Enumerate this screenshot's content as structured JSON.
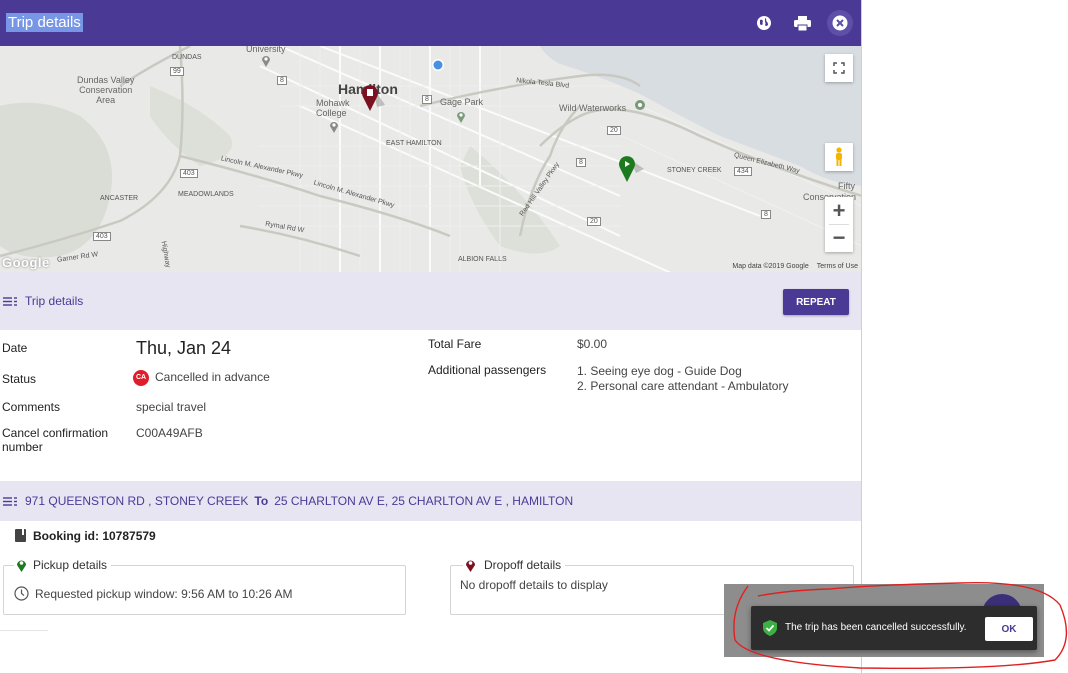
{
  "header": {
    "title": "Trip details",
    "icons": [
      "globe-icon",
      "print-icon",
      "close-icon"
    ]
  },
  "map": {
    "labels": {
      "hamilton": "Hamilton",
      "dundas_valley": "Dundas Valley\nConservation\nArea",
      "dundas": "DUNDAS",
      "university": "University",
      "mohawk": "Mohawk\nCollege",
      "gage_park": "Gage Park",
      "wild_waterworks": "Wild Waterworks",
      "nikola_tesla": "Nikola Tesla Blvd",
      "east_hamilton": "EAST HAMILTON",
      "stoney_creek": "STONEY CREEK",
      "queen_elizabeth": "Queen Elizabeth Way",
      "lincoln_alex": "Lincoln M. Alexander Pkwy",
      "lincoln_alex2": "Lincoln M. Alexander Pkwy",
      "meadowlands": "MEADOWLANDS",
      "ancaster": "ANCASTER",
      "red_hill": "Red Hill Valley Pkwy",
      "rymal": "Rymal Rd W",
      "garner": "Garner Rd W",
      "albion_falls": "ALBION FALLS",
      "fifty": "Fifty",
      "conservation": "Conservation",
      "highway": "Highway"
    },
    "shields": [
      "99",
      "8",
      "8",
      "403",
      "20",
      "8",
      "434",
      "8",
      "20",
      "403"
    ],
    "attribution": "Map data ©2019 Google",
    "terms": "Terms of Use",
    "logo": "Google",
    "zoom_in": "+",
    "zoom_out": "−"
  },
  "trip_section": {
    "title": "Trip details",
    "repeat_label": "REPEAT"
  },
  "details": {
    "date_label": "Date",
    "date_value": "Thu, Jan 24",
    "status_label": "Status",
    "status_badge": "CA",
    "status_value": "Cancelled in advance",
    "comments_label": "Comments",
    "comments_value": "special travel",
    "cancel_label_1": "Cancel confirmation",
    "cancel_label_2": "number",
    "cancel_value": "C00A49AFB",
    "fare_label": "Total Fare",
    "fare_value": "$0.00",
    "passengers_label": "Additional passengers",
    "passengers": [
      "1. Seeing eye dog - Guide Dog",
      "2. Personal care attendant - Ambulatory"
    ]
  },
  "route": {
    "from": "971 QUEENSTON RD , STONEY CREEK",
    "to_label": "To",
    "to": "25 CHARLTON AV E, 25 CHARLTON AV E , HAMILTON"
  },
  "booking": {
    "text": "Booking id: 10787579"
  },
  "pickup": {
    "title": "Pickup details",
    "window": "Requested pickup window: 9:56 AM to 10:26 AM"
  },
  "dropoff": {
    "title": "Dropoff details",
    "message": "No dropoff details to display"
  },
  "snackbar": {
    "message": "The trip has been cancelled successfully.",
    "ok_label": "OK"
  },
  "colors": {
    "brand": "#4a3a96",
    "section_bg": "#e7e5f2",
    "cancel_red": "#e01e2b",
    "pickup_green": "#1e7a1e",
    "dropoff_red": "#7a1020",
    "annotation_red": "#e02020"
  }
}
